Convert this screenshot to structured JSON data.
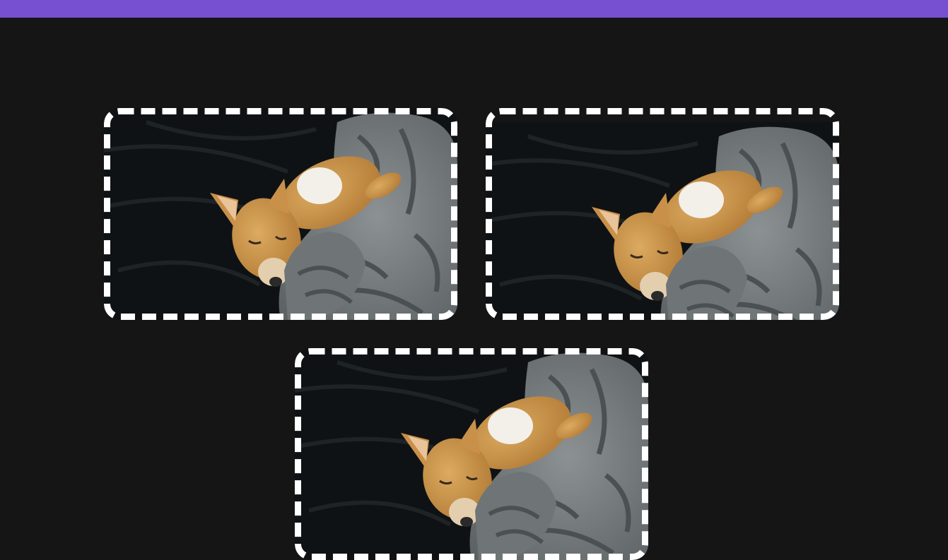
{
  "page": {
    "header_color": "#7650d0",
    "background_color": "#151515",
    "frame_color": "#ffffff"
  },
  "gallery": {
    "items": [
      {
        "subject": "sleeping-dog-photo",
        "crop": "left"
      },
      {
        "subject": "sleeping-dog-photo",
        "crop": "right"
      },
      {
        "subject": "sleeping-dog-photo",
        "crop": "left"
      }
    ]
  }
}
